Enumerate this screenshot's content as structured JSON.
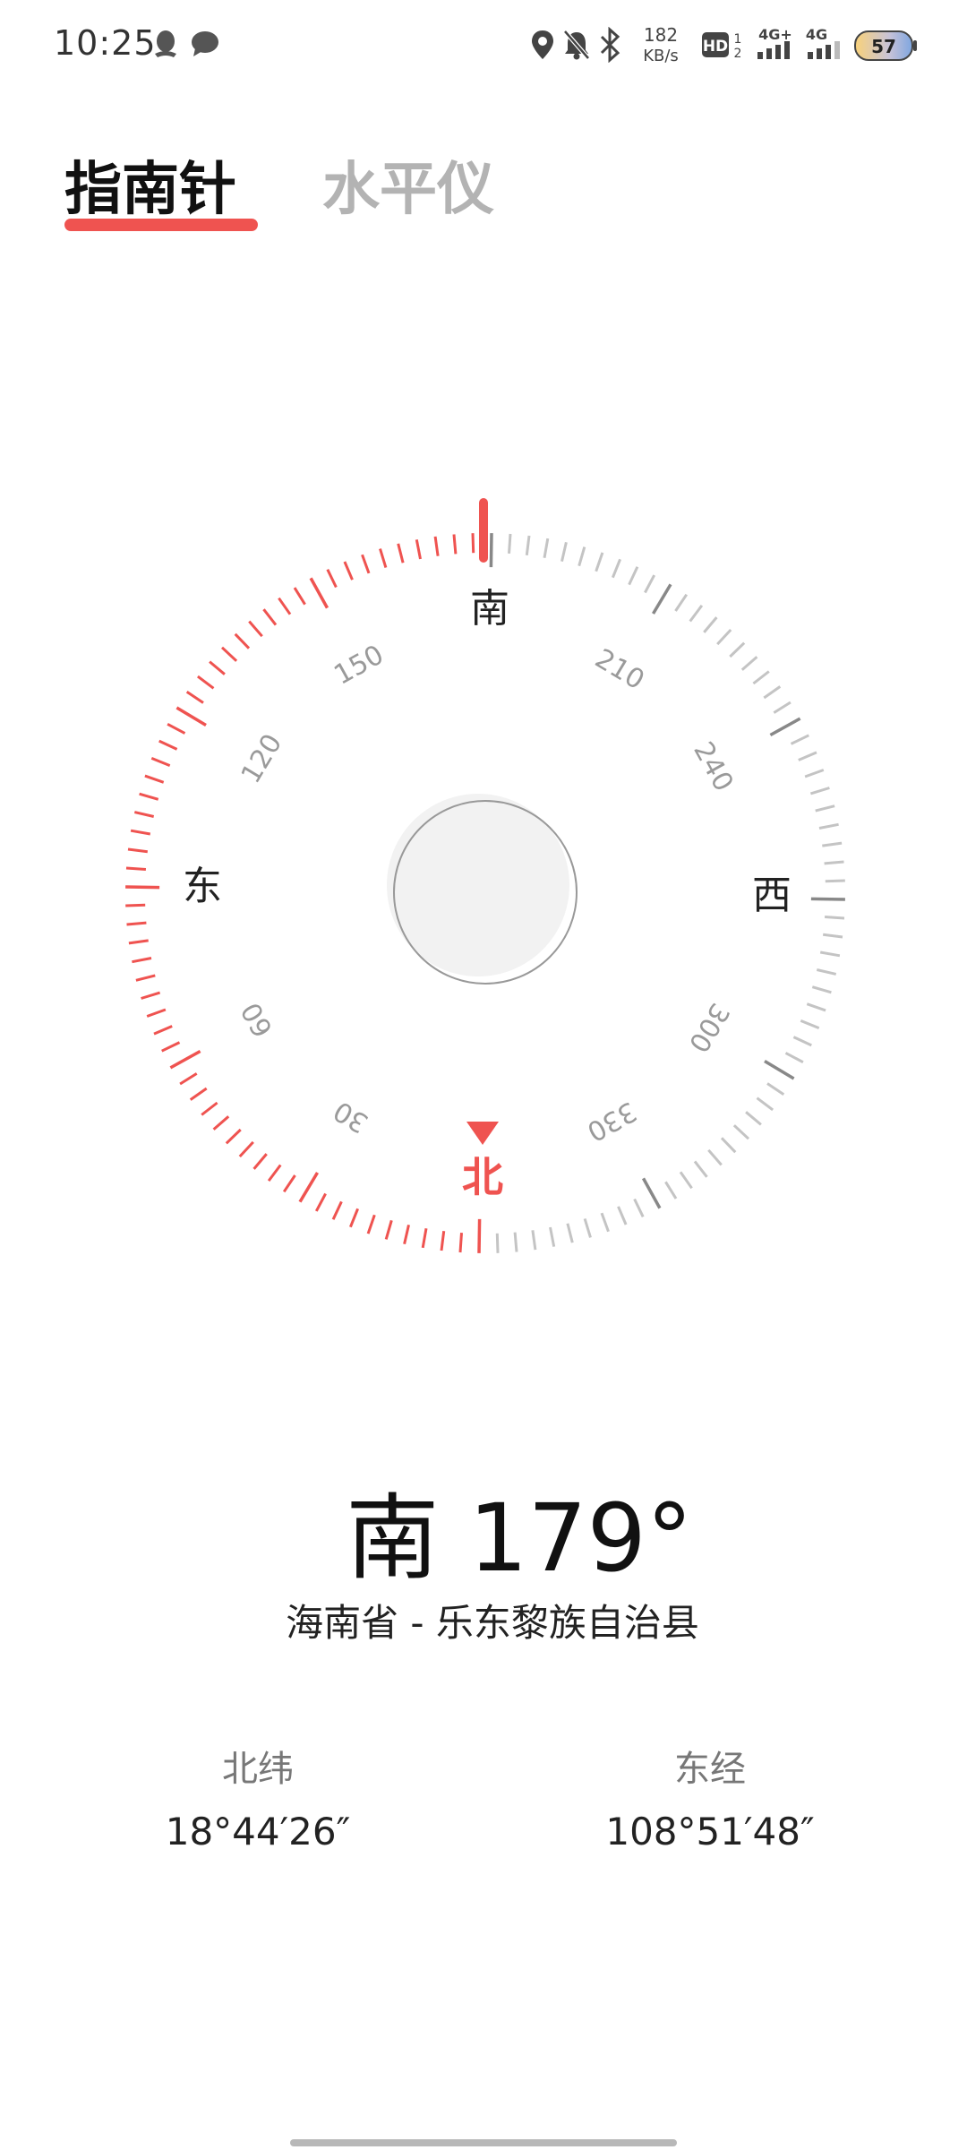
{
  "status_bar": {
    "time": "10:25",
    "net_speed_value": "182",
    "net_speed_unit": "KB/s",
    "hd_badge": "HD",
    "signal1_label": "4G+",
    "signal2_label": "4G",
    "battery": "57",
    "icons": [
      "qq-icon",
      "message-icon",
      "location-icon",
      "mute-icon",
      "bluetooth-icon",
      "hd-icon",
      "signal-icon",
      "signal-icon",
      "battery-icon"
    ]
  },
  "tabs": [
    {
      "label": "指南针",
      "active": true
    },
    {
      "label": "水平仪",
      "active": false
    }
  ],
  "compass": {
    "heading_degrees": 179,
    "cardinals": {
      "north": "北",
      "south": "南",
      "east": "东",
      "west": "西"
    },
    "degree_labels": [
      "30",
      "60",
      "120",
      "150",
      "210",
      "240",
      "300",
      "330"
    ],
    "colors": {
      "accent": "#ef5350",
      "tick": "#c4c4c4",
      "tick_major": "#888888"
    }
  },
  "readout": {
    "direction": "南",
    "degrees": "179°",
    "location": "海南省 - 乐东黎族自治县"
  },
  "coords": {
    "lat_label": "北纬",
    "lat_value": "18°44′26″",
    "lon_label": "东经",
    "lon_value": "108°51′48″"
  }
}
